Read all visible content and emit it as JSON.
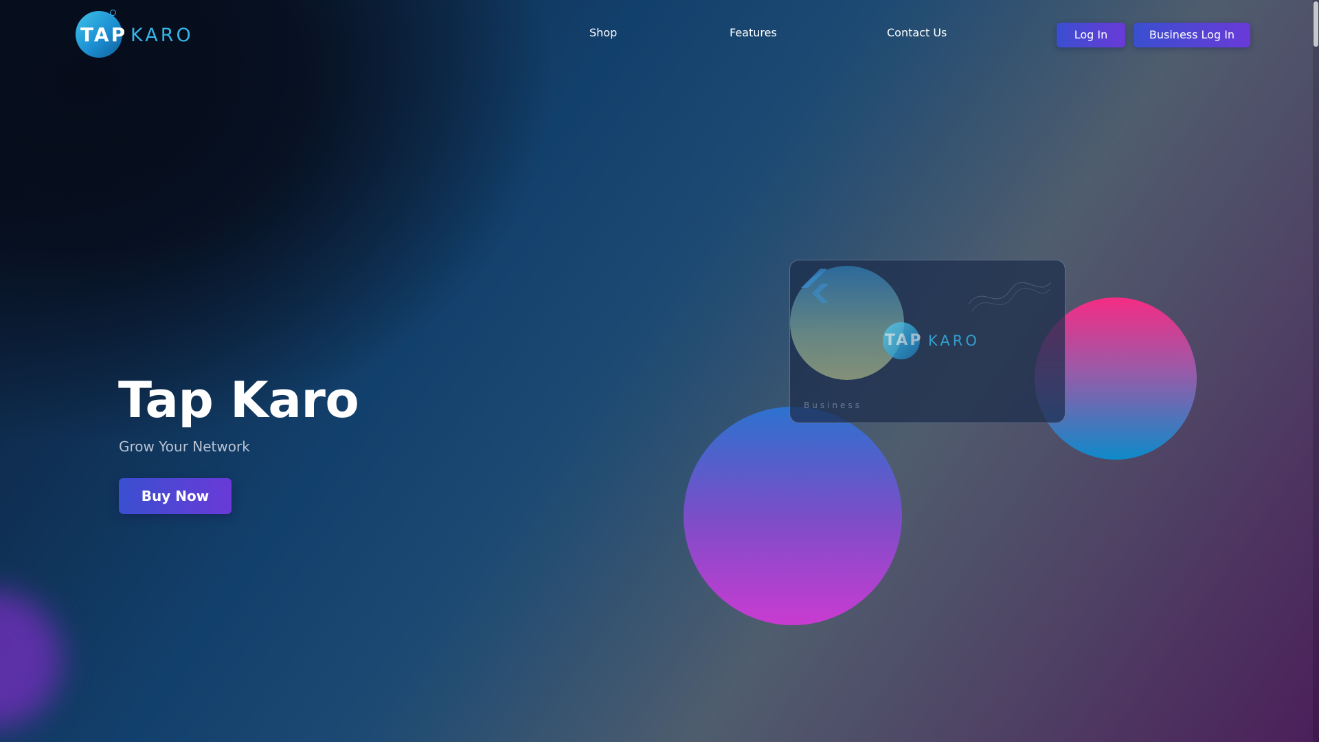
{
  "brand": {
    "logo_tap": "TAP",
    "logo_karo": "KARO",
    "colors": {
      "accent_blue": "#36b6e8",
      "button_gradient_start": "#3a4fd0",
      "button_gradient_end": "#6a3ad8",
      "pink": "#f52c84"
    }
  },
  "nav": {
    "items": [
      {
        "label": "Shop"
      },
      {
        "label": "Features"
      },
      {
        "label": "Contact Us"
      }
    ],
    "login_label": "Log In",
    "business_login_label": "Business Log In"
  },
  "hero": {
    "title": "Tap Karo",
    "subtitle": "Grow Your Network",
    "cta_label": "Buy Now"
  },
  "card": {
    "logo_tap": "TAP",
    "logo_karo": "KARO",
    "label": "Business"
  }
}
